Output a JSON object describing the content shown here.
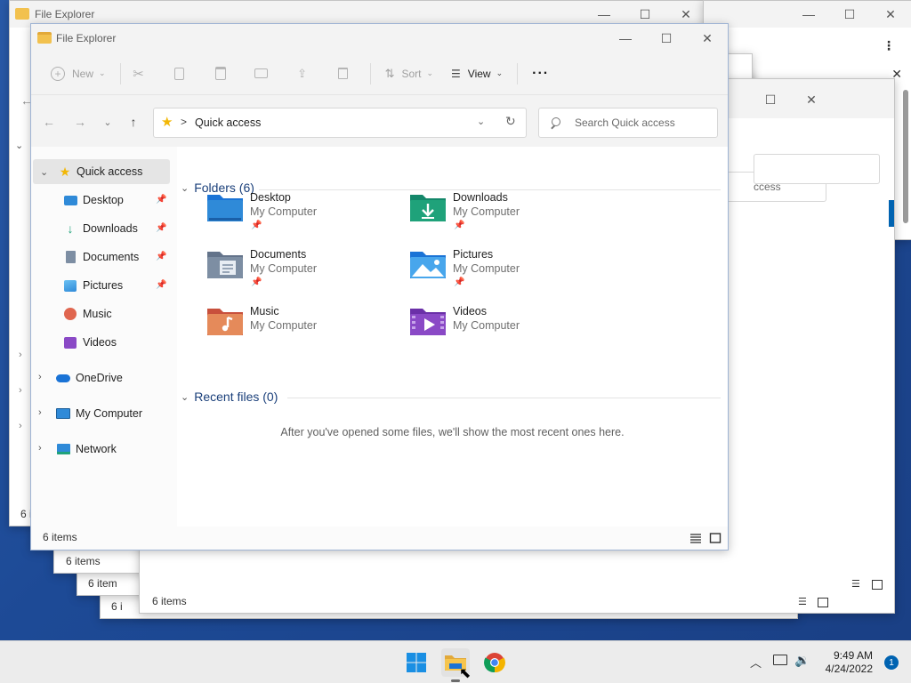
{
  "app": {
    "title": "File Explorer",
    "caption": {
      "minimize": "—",
      "maximize": "☐",
      "close": "✕"
    }
  },
  "background_windows": {
    "title": "File Explorer",
    "status_items": "6 items",
    "status_items_short": "6 i",
    "status_items_trunc": "6 item",
    "search_fragment": "ccess"
  },
  "toolbar": {
    "new_label": "New",
    "sort_label": "Sort",
    "view_label": "View",
    "more_label": "···",
    "icons": [
      "cut-icon",
      "copy-icon",
      "paste-icon",
      "rename-icon",
      "share-icon",
      "delete-icon"
    ]
  },
  "navbar": {
    "back": "←",
    "forward": "→",
    "recent": "⌄",
    "up": "↑",
    "address": "Quick access",
    "address_sep": ">",
    "search_placeholder": "Search Quick access"
  },
  "sidebar": {
    "quick_access": "Quick access",
    "pinned": [
      {
        "label": "Desktop",
        "icon": "desktop-icon"
      },
      {
        "label": "Downloads",
        "icon": "downloads-icon"
      },
      {
        "label": "Documents",
        "icon": "documents-icon"
      },
      {
        "label": "Pictures",
        "icon": "pictures-icon"
      }
    ],
    "unpinned": [
      {
        "label": "Music",
        "icon": "music-icon"
      },
      {
        "label": "Videos",
        "icon": "videos-icon"
      }
    ],
    "roots": [
      {
        "label": "OneDrive",
        "icon": "onedrive-icon"
      },
      {
        "label": "My Computer",
        "icon": "computer-icon"
      },
      {
        "label": "Network",
        "icon": "network-icon"
      }
    ]
  },
  "content": {
    "folders_header": "Folders (6)",
    "folders": [
      {
        "name": "Desktop",
        "location": "My Computer",
        "pinned": true,
        "icon": "desktop-folder-icon"
      },
      {
        "name": "Downloads",
        "location": "My Computer",
        "pinned": true,
        "icon": "downloads-folder-icon"
      },
      {
        "name": "Documents",
        "location": "My Computer",
        "pinned": true,
        "icon": "documents-folder-icon"
      },
      {
        "name": "Pictures",
        "location": "My Computer",
        "pinned": true,
        "icon": "pictures-folder-icon"
      },
      {
        "name": "Music",
        "location": "My Computer",
        "pinned": false,
        "icon": "music-folder-icon"
      },
      {
        "name": "Videos",
        "location": "My Computer",
        "pinned": false,
        "icon": "videos-folder-icon"
      }
    ],
    "recent_header": "Recent files (0)",
    "recent_empty": "After you've opened some files, we'll show the most recent ones here."
  },
  "statusbar": {
    "items": "6 items"
  },
  "taskbar": {
    "icons": [
      "start-icon",
      "file-explorer-icon",
      "chrome-icon"
    ],
    "time": "9:49 AM",
    "date": "4/24/2022",
    "notifications": "1"
  },
  "colors": {
    "accent": "#0063b1",
    "header_text": "#1a3f7a",
    "folder_blue": "#2f8ad8",
    "folder_green": "#1fa27a",
    "folder_gray": "#7d8ea3",
    "folder_orange": "#e0664f",
    "folder_purple": "#8a49c6"
  }
}
